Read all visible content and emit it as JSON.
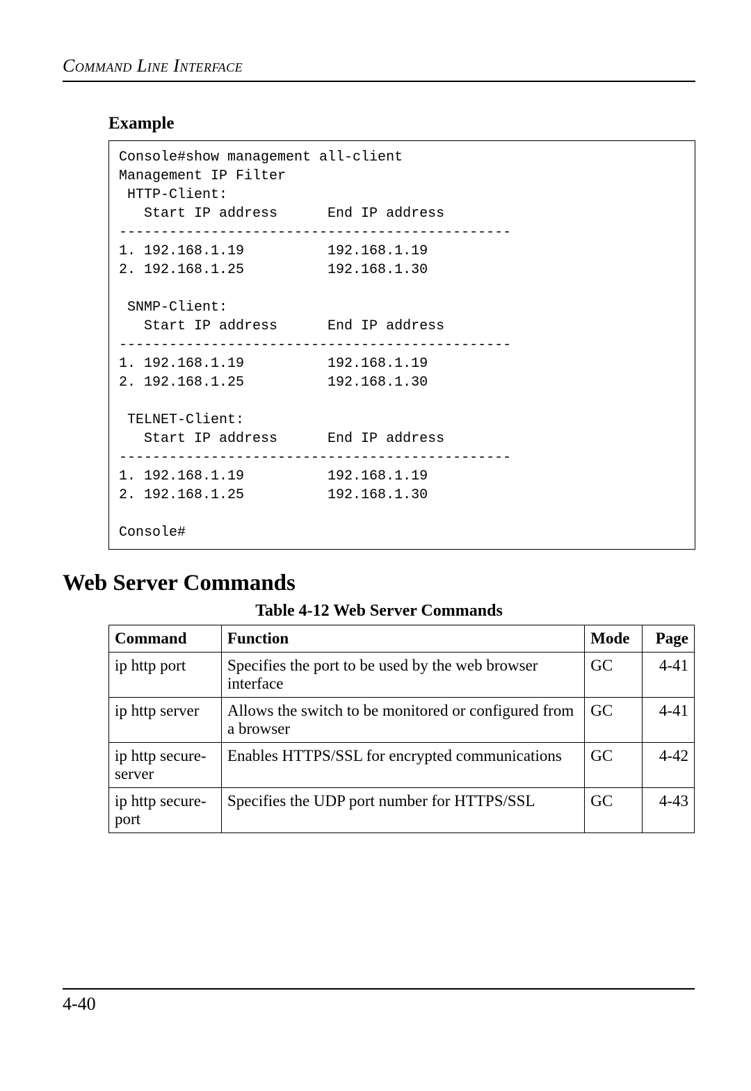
{
  "running_head": "Command Line Interface",
  "example_label": "Example",
  "code": "Console#show management all-client\nManagement IP Filter\n HTTP-Client:\n   Start IP address      End IP address\n-----------------------------------------------\n1. 192.168.1.19          192.168.1.19\n2. 192.168.1.25          192.168.1.30\n\n SNMP-Client:\n   Start IP address      End IP address\n-----------------------------------------------\n1. 192.168.1.19          192.168.1.19\n2. 192.168.1.25          192.168.1.30\n\n TELNET-Client:\n   Start IP address      End IP address\n-----------------------------------------------\n1. 192.168.1.19          192.168.1.19\n2. 192.168.1.25          192.168.1.30\n\nConsole#",
  "section_heading": "Web Server Commands",
  "table_caption": "Table 4-12  Web Server Commands",
  "table": {
    "headers": {
      "command": "Command",
      "function": "Function",
      "mode": "Mode",
      "page": "Page"
    },
    "rows": [
      {
        "command": "ip http port",
        "function": "Specifies the port to be used by the web browser interface",
        "mode": "GC",
        "page": "4-41"
      },
      {
        "command": "ip http server",
        "function": "Allows the switch to be monitored or configured from a browser",
        "mode": "GC",
        "page": "4-41"
      },
      {
        "command": "ip http secure-server",
        "function": "Enables HTTPS/SSL for encrypted communications",
        "mode": "GC",
        "page": "4-42"
      },
      {
        "command": "ip http secure-port",
        "function": "Specifies the UDP port number for HTTPS/SSL",
        "mode": "GC",
        "page": "4-43"
      }
    ]
  },
  "page_number": "4-40"
}
